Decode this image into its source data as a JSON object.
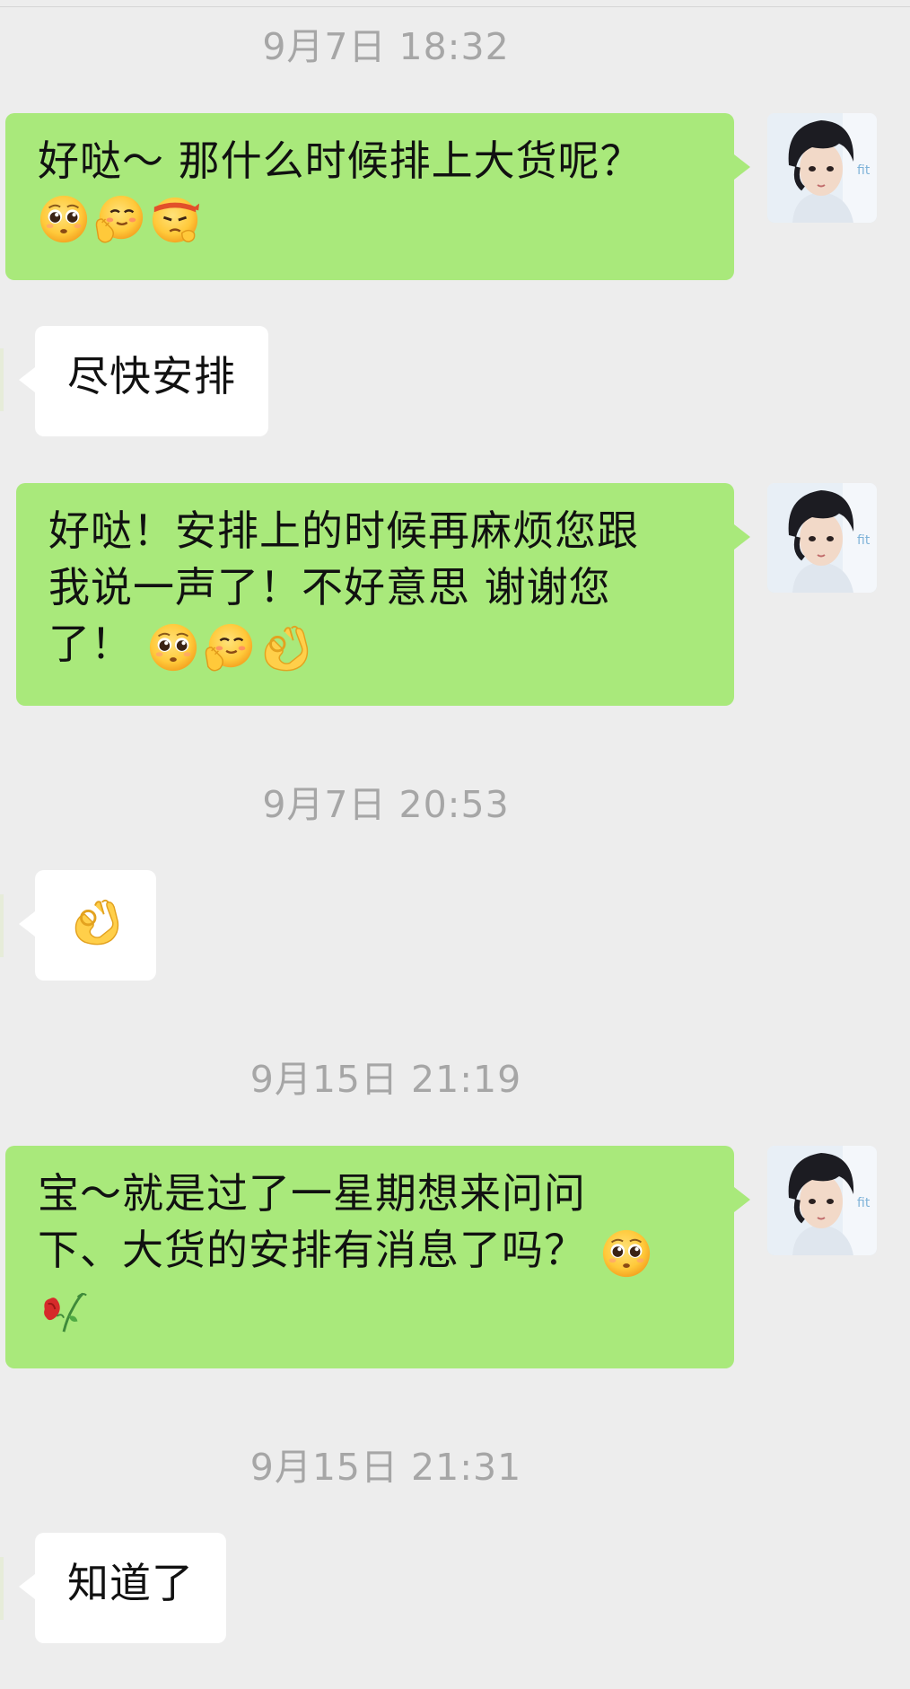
{
  "conversation": {
    "timestamps": [
      "9月7日 18:32",
      "9月7日 20:53",
      "9月15日 21:19",
      "9月15日 21:31"
    ],
    "messages": [
      {
        "side": "out",
        "text": "好哒～ 那什么时候排上大货呢？",
        "emojis": [
          "pleading-face",
          "hand-over-mouth",
          "bandage-head-face"
        ]
      },
      {
        "side": "in",
        "text": "尽快安排"
      },
      {
        "side": "out",
        "text_lines": [
          "好哒！安排上的时候再麻烦您跟",
          "我说一声了！不好意思 谢谢您",
          "了！"
        ],
        "emojis": [
          "pleading-face",
          "hand-over-mouth",
          "ok-hand"
        ]
      },
      {
        "side": "in",
        "emojis": [
          "ok-hand"
        ]
      },
      {
        "side": "out",
        "text_lines": [
          "宝～就是过了一星期想来问问",
          "下、大货的安排有消息了吗？"
        ],
        "emojis": [
          "pleading-face",
          "wilted-rose"
        ]
      },
      {
        "side": "in",
        "text": "知道了"
      }
    ]
  },
  "colors": {
    "background": "#ededed",
    "outgoing_bubble": "#a9e97b",
    "incoming_bubble": "#ffffff",
    "timestamp_text": "#a6a6a6"
  },
  "icons": [
    "pleading-face-icon",
    "hand-over-mouth-icon",
    "bandage-head-face-icon",
    "ok-hand-icon",
    "wilted-rose-icon",
    "avatar"
  ]
}
